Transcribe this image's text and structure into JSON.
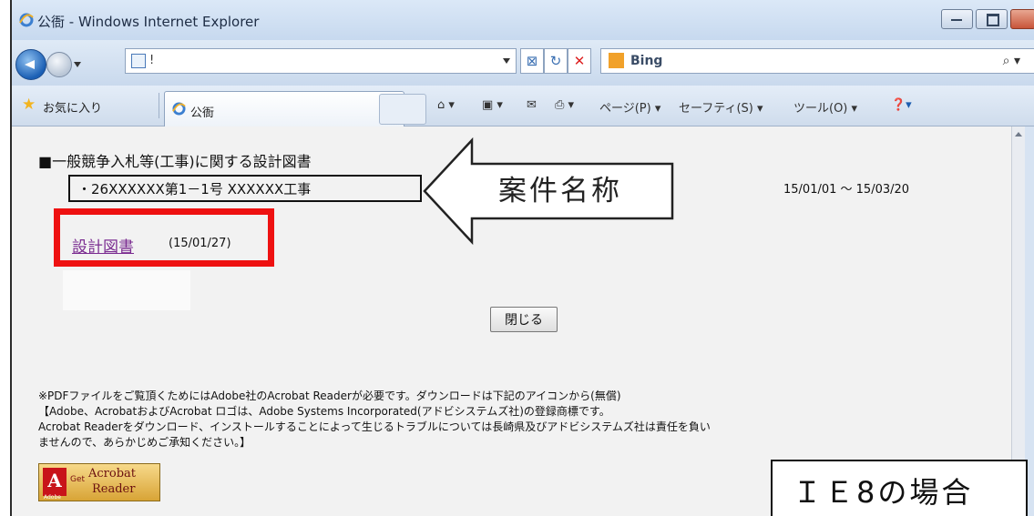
{
  "window": {
    "title": "公衙 - Windows Internet Explorer"
  },
  "navbar": {
    "address": "!",
    "search_provider": "Bing",
    "search_icon": "search-icon"
  },
  "favorites_bar": {
    "favorites_label": "お気に入り",
    "tab_label": "公衙",
    "commands": {
      "page": "ページ(P) ▾",
      "safety": "セーフティ(S) ▾",
      "tools": "ツール(O) ▾"
    }
  },
  "page": {
    "heading": "■一般競争入札等(工事)に関する設計図書",
    "project_name": "・26XXXXXX第1－1号 XXXXXX工事",
    "date_range": "15/01/01 ～ 15/03/20",
    "document_link": "設計図書",
    "document_date": "(15/01/27)",
    "close_button": "閉じる",
    "notice_lines": [
      "※PDFファイルをご覧頂くためにはAdobe社のAcrobat Readerが必要です。ダウンロードは下記のアイコンから(無償)",
      "【Adobe、AcrobatおよびAcrobat ロゴは、Adobe Systems Incorporated(アドビシステムズ社)の登録商標です。",
      "Acrobat Readerをダウンロード、インストールすることによって生じるトラブルについては長崎県及びアドビシステムズ社は責任を負い",
      "ませんので、あらかじめご承知ください。】"
    ],
    "acrobat_badge": {
      "get": "Get",
      "line1": "Acrobat",
      "line2": "Reader",
      "brand": "Adobe"
    }
  },
  "annotations": {
    "callout_label": "案件名称",
    "ie8_label": "ＩＥ8の場合"
  },
  "colors": {
    "highlight_red": "#ee1111",
    "link_purple": "#7b2d91"
  }
}
